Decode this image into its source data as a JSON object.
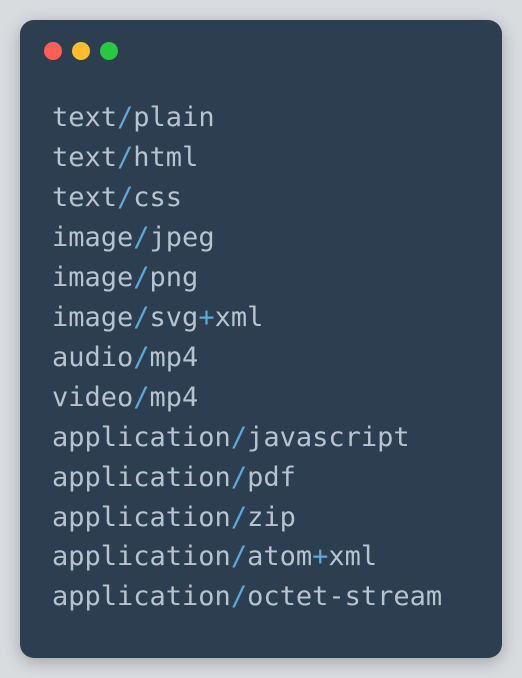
{
  "window": {
    "trafficLights": {
      "close": "#ff5f57",
      "minimize": "#febc2e",
      "maximize": "#28c840"
    }
  },
  "colors": {
    "background": "#2c3e50",
    "text": "#b7c3cf",
    "separator": "#5da9d6",
    "plus": "#5da9d6"
  },
  "mimeTypes": [
    {
      "type": "text",
      "subtype": "plain",
      "suffix": null
    },
    {
      "type": "text",
      "subtype": "html",
      "suffix": null
    },
    {
      "type": "text",
      "subtype": "css",
      "suffix": null
    },
    {
      "type": "image",
      "subtype": "jpeg",
      "suffix": null
    },
    {
      "type": "image",
      "subtype": "png",
      "suffix": null
    },
    {
      "type": "image",
      "subtype": "svg",
      "suffix": "xml"
    },
    {
      "type": "audio",
      "subtype": "mp4",
      "suffix": null
    },
    {
      "type": "video",
      "subtype": "mp4",
      "suffix": null
    },
    {
      "type": "application",
      "subtype": "javascript",
      "suffix": null
    },
    {
      "type": "application",
      "subtype": "pdf",
      "suffix": null
    },
    {
      "type": "application",
      "subtype": "zip",
      "suffix": null
    },
    {
      "type": "application",
      "subtype": "atom",
      "suffix": "xml"
    },
    {
      "type": "application",
      "subtype": "octet-stream",
      "suffix": null
    }
  ]
}
